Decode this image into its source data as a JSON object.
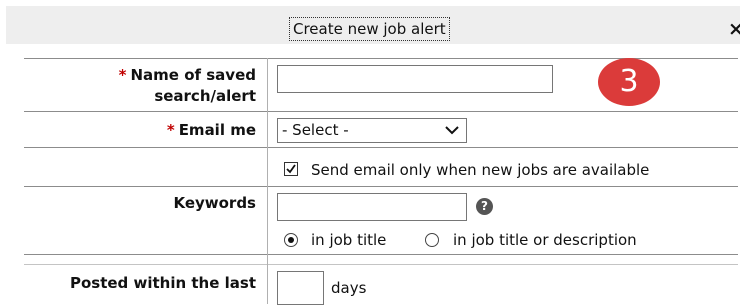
{
  "dialog": {
    "title": "Create new job alert",
    "close_label": "×"
  },
  "badge": {
    "number": "3"
  },
  "form": {
    "name": {
      "required_mark": "*",
      "label_line1": "Name of saved",
      "label_line2": "search/alert",
      "value": ""
    },
    "email": {
      "required_mark": "*",
      "label": "Email me",
      "selected": "- Select -"
    },
    "send_only_new": {
      "checked": true,
      "label": "Send email only when new jobs are available"
    },
    "keywords": {
      "label": "Keywords",
      "value": "",
      "help": "?",
      "scope_options": [
        {
          "label": "in job title",
          "checked": true
        },
        {
          "label": "in job title or description",
          "checked": false
        }
      ]
    },
    "posted": {
      "label": "Posted within the last",
      "value": "",
      "unit": "days"
    }
  },
  "colors": {
    "required": "#c00000",
    "badge": "#db3b3a",
    "titlebar": "#eeeeee"
  }
}
